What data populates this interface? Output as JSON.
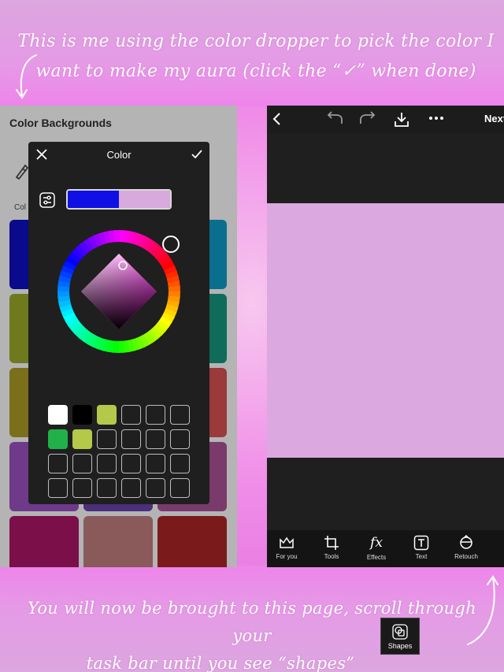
{
  "captions": {
    "top_line1": "This is me using the color dropper to pick the color I",
    "top_line2": "want to make my aura (click the “✓” when done)",
    "bottom_line1": "You will now be brought to this page, scroll through your",
    "bottom_line2": "task bar until you see “shapes”"
  },
  "left_panel": {
    "title": "Color Backgrounds",
    "section_label": "Col",
    "swatch_colors": [
      "#0a0a8c",
      "#7f5a9f",
      "#0a6f8f",
      "#6f7a1f",
      "#4a4f2f",
      "#0f6b5a",
      "#7a6f1a",
      "#6f4f2a",
      "#9a3a3a",
      "#6f3a8a",
      "#4a2f7a",
      "#7a3a6a",
      "#7a0f4a",
      "#8a5a5a",
      "#7a1a1a"
    ],
    "color_dialog": {
      "title": "Color",
      "previous_color": "#1010e6",
      "selected_color": "#d7a9dd",
      "palette": [
        "#ffffff",
        "#000000",
        "#b4c84a",
        "",
        "",
        "",
        "#22b04a",
        "#b4c84a",
        "",
        "",
        "",
        "",
        "",
        "",
        "",
        "",
        "",
        "",
        "",
        "",
        "",
        "",
        "",
        ""
      ]
    }
  },
  "right_panel": {
    "next_label": "Next",
    "canvas_color": "#dba9e0",
    "tools": [
      {
        "label": "For you",
        "icon": "crown-icon"
      },
      {
        "label": "Tools",
        "icon": "crop-icon"
      },
      {
        "label": "Effects",
        "icon": "fx-icon",
        "glyph": "fx"
      },
      {
        "label": "Text",
        "icon": "text-icon"
      },
      {
        "label": "Retouch",
        "icon": "retouch-icon"
      }
    ]
  },
  "shapes_chip": {
    "label": "Shapes",
    "icon": "shapes-icon"
  }
}
